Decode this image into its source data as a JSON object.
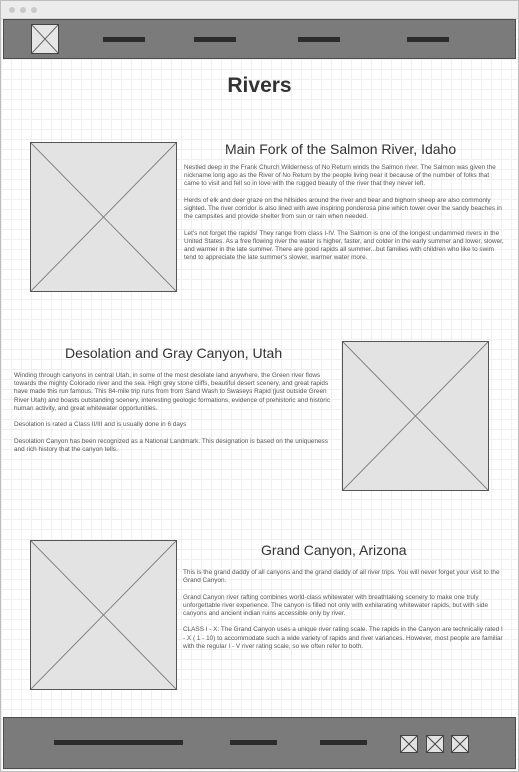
{
  "page": {
    "title": "Rivers"
  },
  "header": {
    "nav_items": [
      "",
      "",
      "",
      ""
    ]
  },
  "sections": [
    {
      "title": "Main Fork of the Salmon River, Idaho",
      "paragraphs": [
        "Nestled deep in the Frank Church Wilderness of No Return winds the Salmon river. The Salmon was given the nickname long ago as the River of No Return by the people living near it because of the number of folks that came to visit and fell so in love with the rugged beauty of the river that they never left.",
        "Herds of elk and deer graze on the hillsides around the river and bear and bighorn sheep are also commonly sighted. The river corridor is also lined with awe inspiring ponderosa pine which tower over the sandy beaches in the campsites and provide shelter from sun or rain when needed.",
        "Let's not forget the rapids! They range from class I-IV. The Salmon is one of the longest undammed rivers in the United States. As a free flowing river the water is higher, faster, and colder in the early summer and lower, slower, and warmer in the late summer. There are good rapids all summer...but families with children who like to swim tend to appreciate the late summer's slower, warmer water more."
      ]
    },
    {
      "title": "Desolation and Gray Canyon, Utah",
      "paragraphs": [
        "Winding through canyons in central Utah, in some of the most desolate land anywhere, the Green river flows towards the mighty Colorado river and the sea. High grey stone cliffs, beautiful desert scenery, and great rapids have made this run famous. This 84-mile trip runs from from Sand Wash to Swaseys Rapid (just outside Green River Utah) and boasts outstanding scenery, interesting geologic formations, evidence of prehistoric and historic human activity, and great whitewater opportunities.",
        "Desolation is rated a Class II/III and is usually done in 6 days",
        "Desolation Canyon has been recognized as a National Landmark. This designation is based on the uniqueness and rich history that the canyon tells."
      ]
    },
    {
      "title": "Grand Canyon, Arizona",
      "paragraphs": [
        "This is the grand daddy of all canyons and the grand daddy of all river trips. You will never forget your visit to the Grand Canyon.",
        "Grand Canyon river rafting combines world-class whitewater with breathtaking scenery to make one truly unforgettable river experience. The canyon is filled not only with exhilarating whitewater rapids, but with side canyons and ancient indian ruins accessible only by river.",
        "CLASS I - X: The Grand Canyon uses a unique river rating scale. The rapids in the Canyon are technically rated I - X ( 1 - 10) to accommodate such a wide variety of rapids and river variances. However, most people are familiar with the regular I - V river rating scale, so we often refer to both."
      ]
    }
  ],
  "footer": {
    "links": [
      "",
      "",
      ""
    ],
    "social_icons": [
      "social-icon-1",
      "social-icon-2",
      "social-icon-3"
    ]
  },
  "colors": {
    "bar_fill": "#7b7b7b",
    "placeholder_fill": "#e3e3e3",
    "text": "#555555"
  }
}
